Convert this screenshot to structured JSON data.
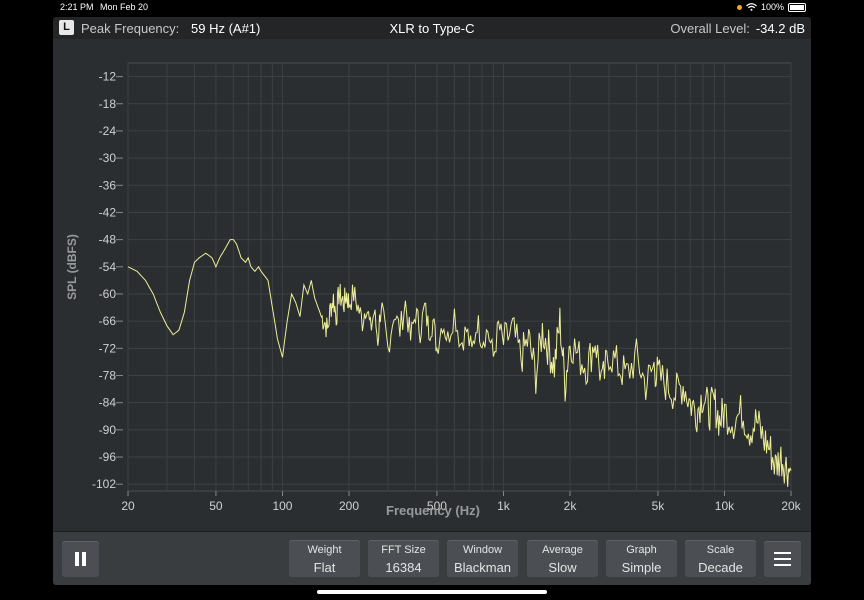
{
  "status": {
    "time": "2:21 PM",
    "date": "Mon Feb 20",
    "battery": "100%"
  },
  "topbar": {
    "channel": "L",
    "peak_label": "Peak Frequency:",
    "peak_value": "59 Hz (A#1)",
    "title": "XLR to Type-C",
    "overall_label": "Overall Level:",
    "overall_value": "-34.2 dB"
  },
  "controls": [
    {
      "label": "Weight",
      "value": "Flat"
    },
    {
      "label": "FFT Size",
      "value": "16384"
    },
    {
      "label": "Window",
      "value": "Blackman"
    },
    {
      "label": "Average",
      "value": "Slow"
    },
    {
      "label": "Graph",
      "value": "Simple"
    },
    {
      "label": "Scale",
      "value": "Decade"
    }
  ],
  "colors": {
    "trace": "#eeee99",
    "background": "#2b2e30",
    "grid": "#3d4043"
  },
  "chart_data": {
    "type": "line",
    "xlabel": "Frequency (Hz)",
    "ylabel": "SPL (dBFS)",
    "xscale": "log",
    "xlim": [
      20,
      20000
    ],
    "ylim": [
      -103.5,
      -9
    ],
    "x_ticks": [
      20,
      50,
      100,
      200,
      500,
      1000,
      2000,
      5000,
      10000,
      20000
    ],
    "x_tick_labels": [
      "20",
      "50",
      "100",
      "200",
      "500",
      "1k",
      "2k",
      "5k",
      "10k",
      "20k"
    ],
    "y_ticks": [
      -12,
      -18,
      -24,
      -30,
      -36,
      -42,
      -48,
      -54,
      -60,
      -66,
      -72,
      -78,
      -84,
      -90,
      -96,
      -102
    ],
    "y_tick_labels": [
      "-12",
      "-18",
      "-24",
      "-30",
      "-36",
      "-42",
      "-48",
      "-54",
      "-60",
      "-66",
      "-72",
      "-78",
      "-84",
      "-90",
      "-96",
      "-102"
    ],
    "grid": true,
    "series": [
      {
        "x": [
          20,
          22,
          24,
          26,
          28,
          30,
          32,
          34,
          36,
          38,
          40,
          42,
          45,
          48,
          50,
          52,
          55,
          58,
          60,
          62,
          65,
          68,
          70,
          72,
          75,
          78,
          80,
          83,
          86,
          90,
          95,
          100,
          105,
          110,
          115,
          120,
          125,
          130,
          135,
          140,
          145,
          150,
          155,
          160,
          165,
          170,
          175,
          180,
          185,
          190,
          195,
          200,
          210,
          220,
          230,
          240,
          250,
          260,
          270,
          280,
          290,
          300,
          320,
          340,
          360,
          380,
          400,
          420,
          440,
          460,
          480,
          500,
          530,
          560,
          600,
          640,
          680,
          720,
          760,
          800,
          850,
          900,
          950,
          1000,
          1100,
          1200,
          1300,
          1400,
          1500,
          1600,
          1700,
          1800,
          1900,
          2000,
          2200,
          2400,
          2600,
          2800,
          3000,
          3300,
          3600,
          4000,
          4400,
          4800,
          5000,
          5500,
          6000,
          6500,
          7000,
          7500,
          8000,
          8500,
          9000,
          9500,
          10000,
          11000,
          12000,
          13000,
          14000,
          15000,
          16000,
          17000,
          18000,
          19000,
          20000
        ],
        "y": [
          -54,
          -55,
          -57,
          -60,
          -64,
          -67,
          -69,
          -68,
          -64,
          -57,
          -53,
          -52,
          -51,
          -52,
          -54,
          -52,
          -50,
          -48,
          -48,
          -49,
          -52,
          -53,
          -52,
          -54,
          -55,
          -54,
          -55,
          -56,
          -57,
          -63,
          -70,
          -74,
          -66,
          -60,
          -62,
          -65,
          -58,
          -60,
          -57,
          -61,
          -63,
          -65,
          -66,
          -68,
          -63,
          -61,
          -65,
          -60,
          -61,
          -62,
          -60,
          -62,
          -60,
          -63,
          -66,
          -62,
          -68,
          -64,
          -70,
          -62,
          -68,
          -72,
          -64,
          -68,
          -62,
          -70,
          -64,
          -68,
          -63,
          -68,
          -66,
          -72,
          -66,
          -70,
          -64,
          -71,
          -68,
          -73,
          -66,
          -70,
          -68,
          -74,
          -67,
          -71,
          -68,
          -74,
          -70,
          -78,
          -68,
          -72,
          -76,
          -66,
          -80,
          -70,
          -74,
          -76,
          -70,
          -80,
          -73,
          -76,
          -78,
          -74,
          -80,
          -76,
          -78,
          -80,
          -82,
          -80,
          -84,
          -86,
          -82,
          -86,
          -84,
          -88,
          -86,
          -88,
          -86,
          -90,
          -88,
          -92,
          -94,
          -98,
          -96,
          -98,
          -99
        ]
      }
    ]
  }
}
